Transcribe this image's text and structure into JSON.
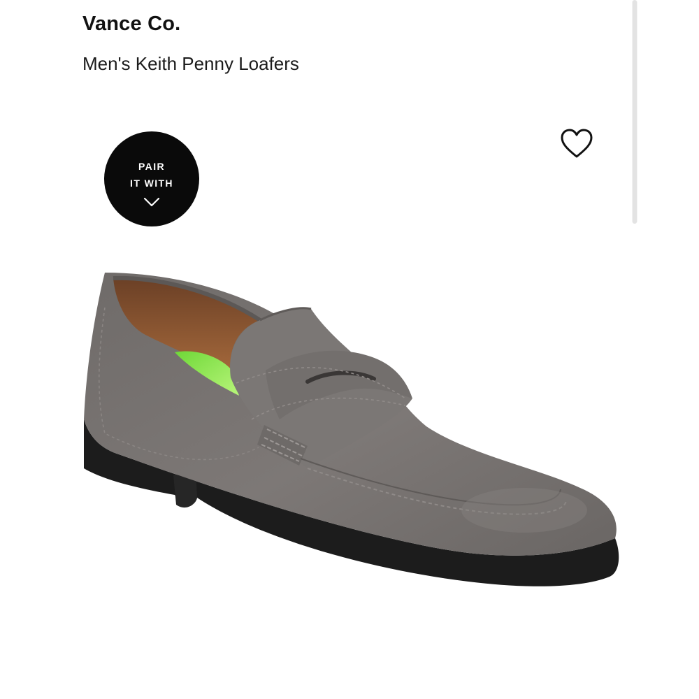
{
  "product": {
    "brand": "Vance Co.",
    "name": "Men's Keith Penny Loafers"
  },
  "pair_badge": {
    "line1": "PAIR",
    "line2": "IT WITH",
    "icon": "chevron-down-icon"
  },
  "wishlist": {
    "icon": "heart-outline-icon"
  },
  "colors": {
    "badge_background": "#0a0a0a",
    "shoe_upper": "#7a7674",
    "shoe_sole": "#1e1e1e",
    "insole": "#8ee85a"
  }
}
